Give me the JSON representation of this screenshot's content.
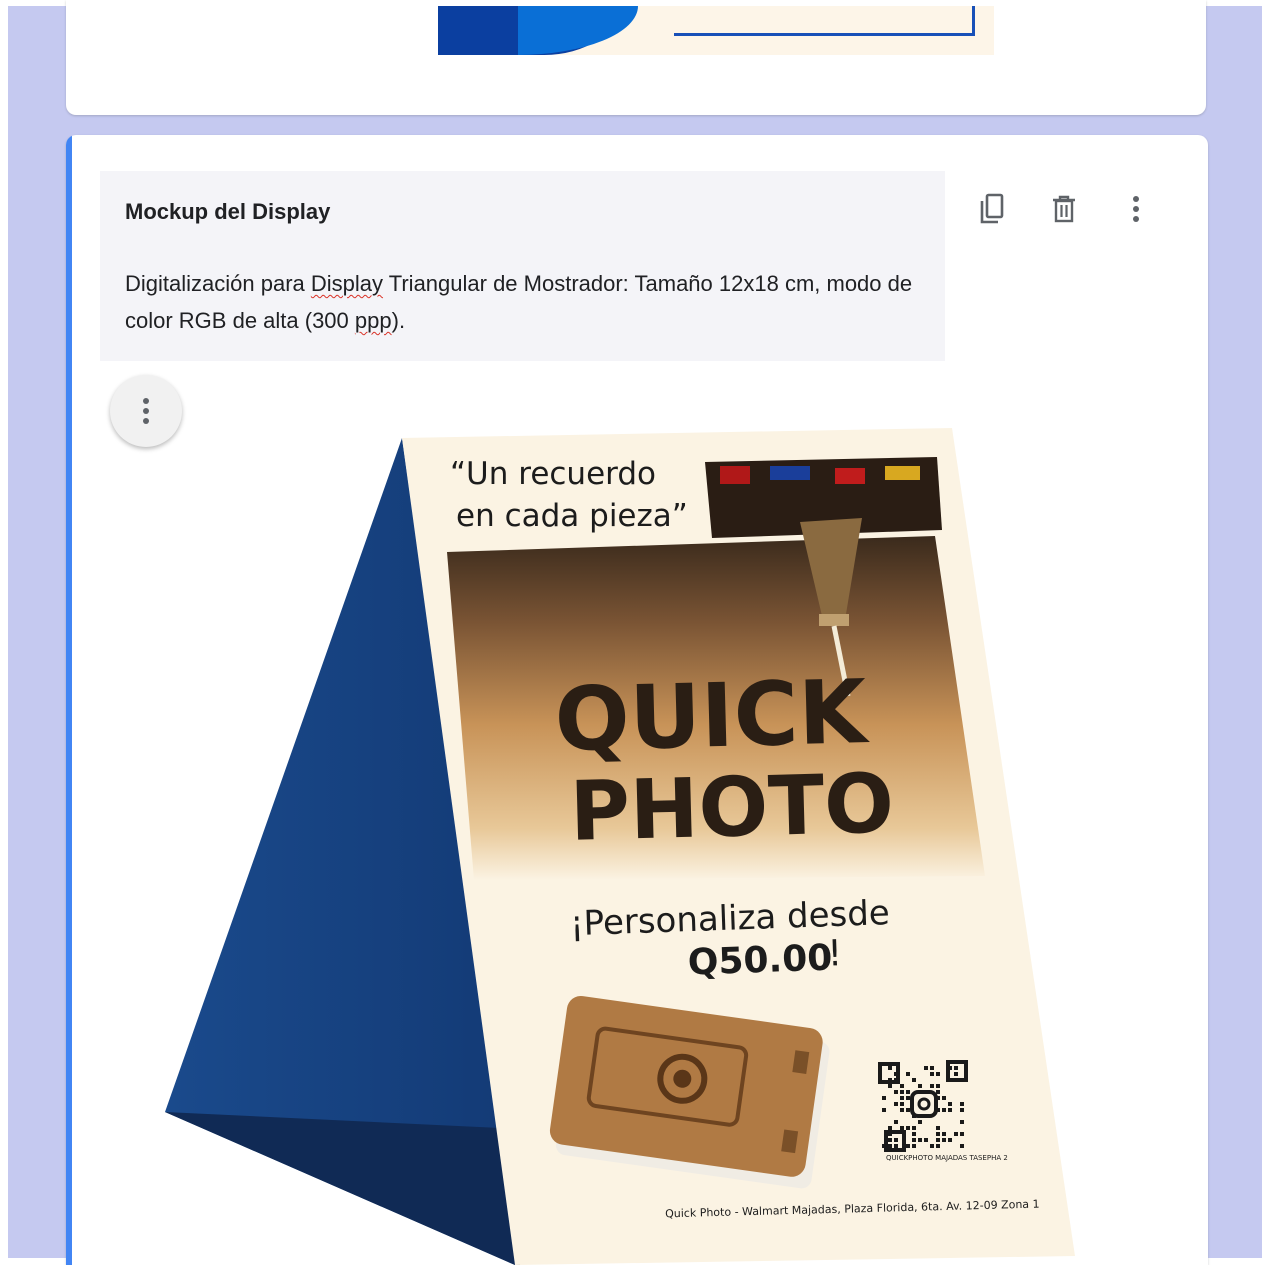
{
  "item": {
    "title": "Mockup del Display",
    "description_parts": [
      "Digitalización para ",
      "Display",
      " Triangular de Mostrador: Tamaño 12x18 cm, modo de color RGB de alta (300 ",
      "ppp",
      ")."
    ]
  },
  "toolbar": {
    "icons": [
      "copy-icon",
      "delete-icon",
      "more-vert-icon"
    ]
  },
  "image_menu": {
    "icon": "more-vert-icon"
  },
  "mockup": {
    "quote_line1": "“Un recuerdo",
    "quote_line2": "en cada pieza”",
    "brand_line1": "QUICK",
    "brand_line2": "PHOTO",
    "promo_line1": "¡Personaliza desde",
    "promo_price": "Q50.00",
    "promo_bang": "!",
    "qr_caption": "QUICKPHOTO MAJADAS TASEPHA 2",
    "footer": "Quick Photo - Walmart Majadas, Plaza Florida, 6ta. Av. 12-09 Zona 1",
    "colors": {
      "front_panel": "#fbf3e3",
      "side_panel": "#16407f",
      "shadow_panel": "#102a55",
      "wood": "#c08a52"
    }
  },
  "colors": {
    "page_bg": "#c5c9f0",
    "focus_bar": "#4285f4",
    "header_bg": "#f4f4f8"
  }
}
